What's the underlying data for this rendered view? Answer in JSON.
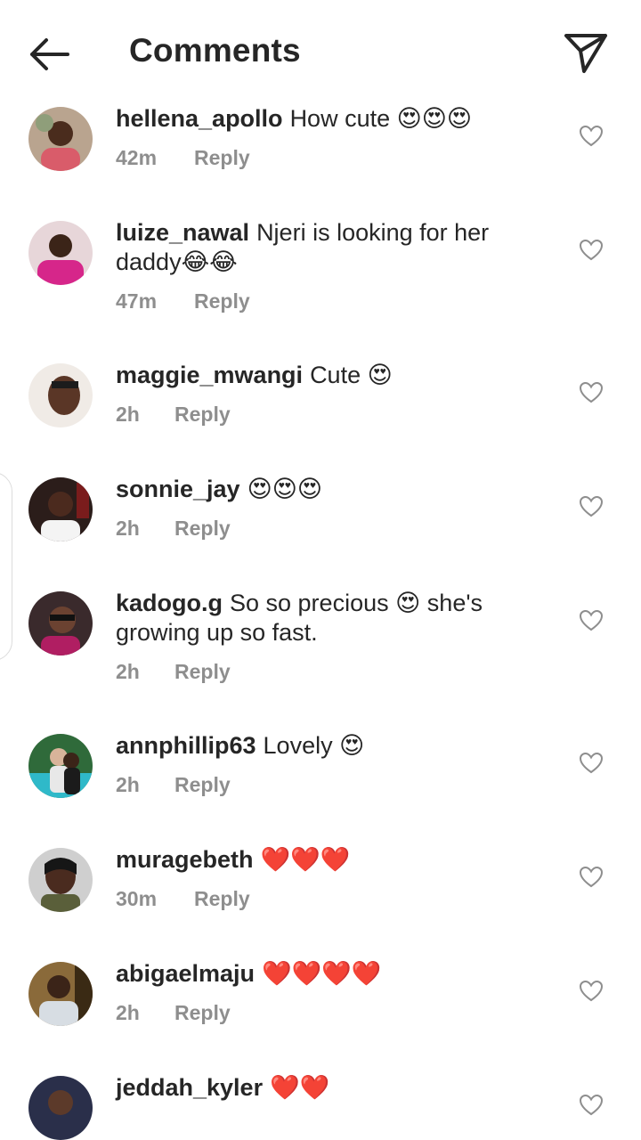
{
  "header": {
    "title": "Comments",
    "back_icon": "arrow-left-icon",
    "share_icon": "send-icon"
  },
  "colors": {
    "text": "#262626",
    "meta": "#8e8e8e",
    "heart_emoji": "#e0212f"
  },
  "comments": [
    {
      "username": "hellena_apollo",
      "text": "How cute",
      "emoji": "😍😍😍",
      "time": "42m",
      "reply": "Reply"
    },
    {
      "username": "luize_nawal",
      "text": "Njeri is looking for her daddy",
      "emoji": "😂😂",
      "time": "47m",
      "reply": "Reply"
    },
    {
      "username": "maggie_mwangi",
      "text": "Cute",
      "emoji": "😍",
      "time": "2h",
      "reply": "Reply"
    },
    {
      "username": "sonnie_jay",
      "text": "",
      "emoji": "😍😍😍",
      "time": "2h",
      "reply": "Reply"
    },
    {
      "username": "kadogo.g",
      "text": "So so precious",
      "emoji": "😍",
      "text_after": "she's growing up so fast.",
      "time": "2h",
      "reply": "Reply"
    },
    {
      "username": "annphillip63",
      "text": "Lovely",
      "emoji": "😍",
      "time": "2h",
      "reply": "Reply"
    },
    {
      "username": "muragebeth",
      "text": "",
      "emoji": "❤️❤️❤️",
      "time": "30m",
      "reply": "Reply"
    },
    {
      "username": "abigaelmaju",
      "text": "",
      "emoji": "❤️❤️❤️❤️",
      "time": "2h",
      "reply": "Reply"
    },
    {
      "username": "jeddah_kyler",
      "text": "",
      "emoji": "❤️❤️",
      "time": "",
      "reply": ""
    }
  ]
}
